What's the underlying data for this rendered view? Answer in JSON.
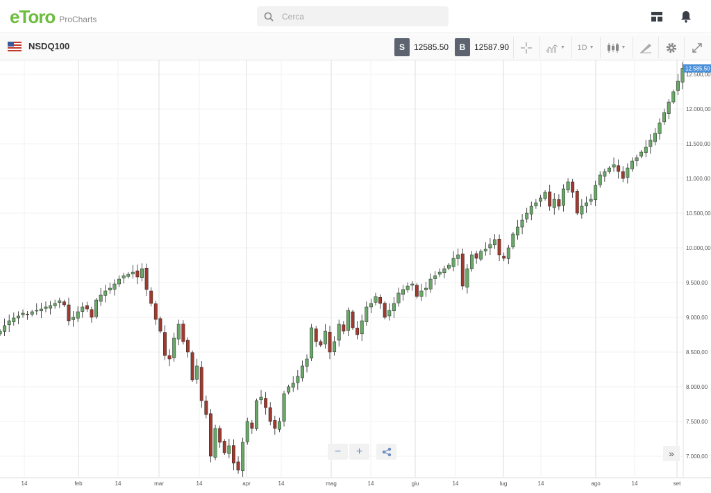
{
  "app": {
    "logo_text": "eToro",
    "product": "ProCharts",
    "brand_color": "#6cbd3c"
  },
  "search": {
    "placeholder": "Cerca"
  },
  "toolbar": {
    "symbol": "NSDQ100",
    "sell_label": "S",
    "sell_price": "12585.50",
    "buy_label": "B",
    "buy_price": "12587.90",
    "timeframe": "1D",
    "icons": [
      "crosshair-icon",
      "chart-type-icon",
      "candles-icon",
      "draw-tools-icon",
      "settings-icon",
      "fullscreen-icon"
    ]
  },
  "chart_data": {
    "type": "candlestick",
    "series": [
      {
        "name": "NSDQ100"
      }
    ],
    "y_ticks": [
      "7.000,00",
      "7.500,00",
      "8.000,00",
      "8.500,00",
      "9.000,00",
      "9.500,00",
      "10.000,00",
      "10.500,00",
      "11.000,00",
      "11.500,00",
      "12.000,00",
      "12.500,00"
    ],
    "y_range": [
      6700,
      12700
    ],
    "x_ticks": [
      "14",
      "feb",
      "14",
      "mar",
      "14",
      "apr",
      "14",
      "mag",
      "14",
      "giu",
      "14",
      "lug",
      "14",
      "ago",
      "14",
      "set"
    ],
    "last_price_label": "12.585,50",
    "last_price_color": "#4a90d9",
    "up_color": "#6aa86a",
    "down_color": "#a0392e",
    "grid": true,
    "closes": [
      8800,
      8880,
      8950,
      8990,
      9020,
      9060,
      9040,
      9080,
      9100,
      9120,
      9150,
      9170,
      9200,
      9240,
      9180,
      8950,
      9000,
      9080,
      9150,
      9120,
      9000,
      9250,
      9320,
      9380,
      9420,
      9480,
      9550,
      9600,
      9620,
      9650,
      9580,
      9700,
      9400,
      9200,
      8970,
      8800,
      8450,
      8400,
      8700,
      8900,
      8650,
      8500,
      8100,
      8300,
      7800,
      7600,
      7000,
      7400,
      7200,
      7050,
      7150,
      6900,
      6800,
      7200,
      7500,
      7400,
      7800,
      7850,
      7700,
      7500,
      7400,
      7500,
      7900,
      8000,
      8050,
      8150,
      8300,
      8400,
      8850,
      8650,
      8600,
      8800,
      8500,
      8650,
      8900,
      8800,
      9100,
      8850,
      8750,
      8950,
      9150,
      9200,
      9300,
      9200,
      9000,
      9100,
      9200,
      9350,
      9400,
      9450,
      9480,
      9300,
      9380,
      9420,
      9550,
      9600,
      9650,
      9700,
      9750,
      9850,
      9900,
      9450,
      9700,
      9900,
      9850,
      9950,
      9980,
      10050,
      10120,
      9900,
      9850,
      10000,
      10200,
      10300,
      10400,
      10500,
      10600,
      10650,
      10720,
      10800,
      10600,
      10700,
      10600,
      10850,
      10950,
      10800,
      10500,
      10600,
      10650,
      10700,
      10900,
      11050,
      11100,
      11150,
      11200,
      11100,
      11000,
      11150,
      11250,
      11300,
      11380,
      11450,
      11550,
      11650,
      11800,
      11950,
      12100,
      12250,
      12400,
      12585
    ]
  }
}
